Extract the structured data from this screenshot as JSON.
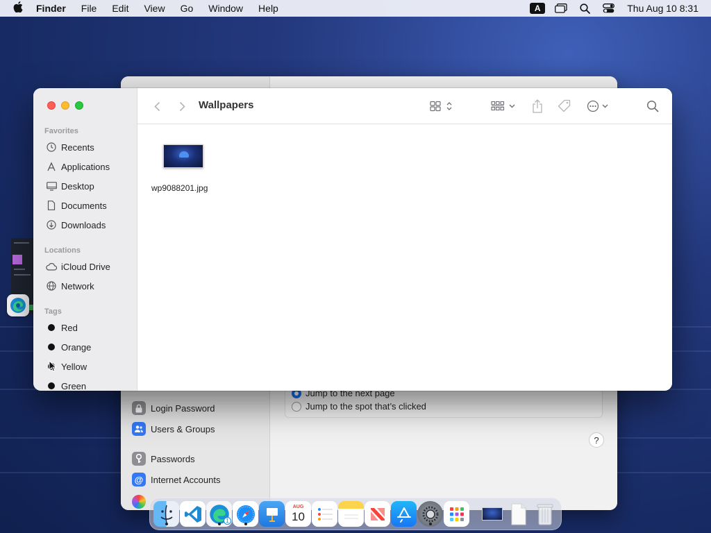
{
  "menubar": {
    "app_name": "Finder",
    "menus": [
      "File",
      "Edit",
      "View",
      "Go",
      "Window",
      "Help"
    ],
    "input_source": "A",
    "clock": "Thu Aug 10  8:31"
  },
  "finder": {
    "title": "Wallpapers",
    "sidebar": {
      "favorites_header": "Favorites",
      "favorites": [
        {
          "label": "Recents",
          "icon": "clock-icon"
        },
        {
          "label": "Applications",
          "icon": "applications-icon"
        },
        {
          "label": "Desktop",
          "icon": "desktop-icon"
        },
        {
          "label": "Documents",
          "icon": "document-icon"
        },
        {
          "label": "Downloads",
          "icon": "download-icon"
        }
      ],
      "locations_header": "Locations",
      "locations": [
        {
          "label": "iCloud Drive",
          "icon": "cloud-icon"
        },
        {
          "label": "Network",
          "icon": "globe-icon"
        }
      ],
      "tags_header": "Tags",
      "tags": [
        {
          "label": "Red"
        },
        {
          "label": "Orange"
        },
        {
          "label": "Yellow"
        },
        {
          "label": "Green"
        }
      ]
    },
    "files": [
      {
        "name": "wp9088201.jpg"
      }
    ]
  },
  "settings": {
    "sidebar": [
      {
        "label": "Login Password",
        "color": "#8e8e93"
      },
      {
        "label": "Users & Groups",
        "color": "#3478f6"
      },
      {
        "label": "Passwords",
        "color": "#8e8e93"
      },
      {
        "label": "Internet Accounts",
        "color": "#3478f6"
      }
    ],
    "options": [
      {
        "label": "Jump to the next page",
        "selected": true
      },
      {
        "label": "Jump to the spot that’s clicked",
        "selected": false
      }
    ],
    "help": "?"
  },
  "dock": {
    "calendar_month": "AUG",
    "calendar_day": "10",
    "edge_badge": "1"
  }
}
